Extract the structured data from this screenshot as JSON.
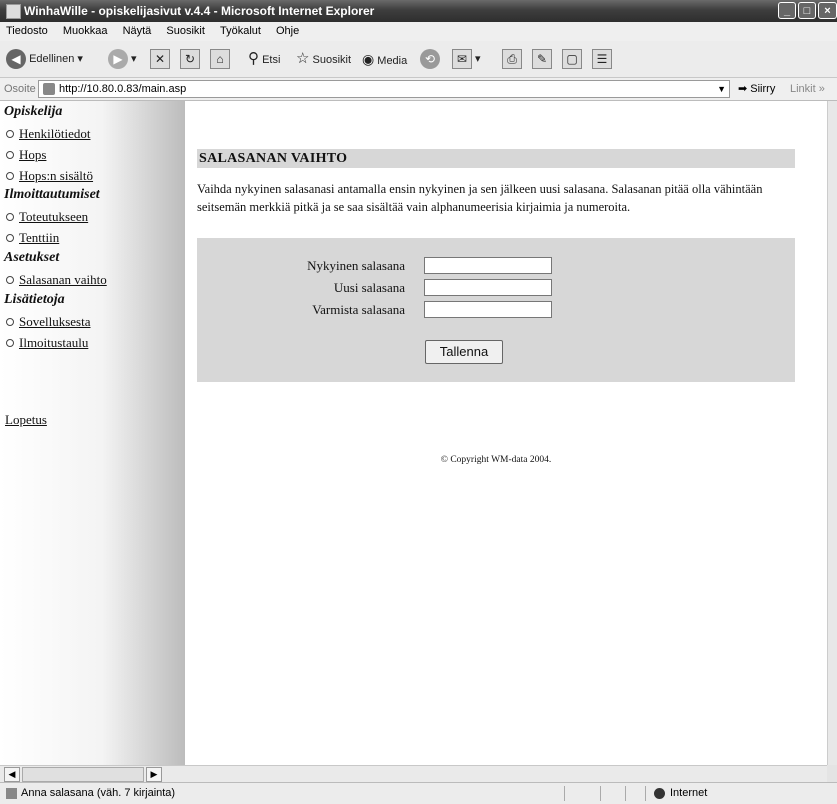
{
  "window": {
    "title": "WinhaWille - opiskelijasivut v.4.4 - Microsoft Internet Explorer",
    "controls": {
      "minimize": "_",
      "maximize": "□",
      "close": "×"
    }
  },
  "menu": [
    "Tiedosto",
    "Muokkaa",
    "Näytä",
    "Suosikit",
    "Työkalut",
    "Ohje"
  ],
  "toolbar": {
    "back_label": "Edellinen",
    "search_label": "Etsi",
    "favorites_label": "Suosikit",
    "media_label": "Media",
    "icons": [
      "back-icon",
      "forward-icon",
      "stop-icon",
      "refresh-icon",
      "home-icon",
      "search-icon",
      "favorites-icon",
      "media-icon",
      "history-icon",
      "mail-icon",
      "print-icon",
      "edit-icon",
      "discuss-icon",
      "research-icon"
    ]
  },
  "address": {
    "label": "Osoite",
    "url": "http://10.80.0.83/main.asp",
    "go_label": "Siirry",
    "links_label": "Linkit"
  },
  "sidebar": {
    "sections": [
      {
        "title": "Opiskelija",
        "items": [
          "Henkilötiedot",
          "Hops",
          "Hops:n sisältö"
        ]
      },
      {
        "title": "Ilmoittautumiset",
        "items": [
          "Toteutukseen",
          "Tenttiin"
        ]
      },
      {
        "title": "Asetukset",
        "items": [
          "Salasanan vaihto"
        ]
      },
      {
        "title": "Lisätietoja",
        "items": [
          "Sovelluksesta",
          "Ilmoitustaulu"
        ]
      }
    ],
    "logout": "Lopetus"
  },
  "main": {
    "heading": "SALASANAN VAIHTO",
    "description": "Vaihda nykyinen salasanasi antamalla ensin nykyinen ja sen jälkeen uusi salasana. Salasanan pitää olla vähintään seitsemän merkkiä pitkä ja se saa sisältää vain alphanumeerisia kirjaimia ja numeroita.",
    "fields": {
      "current_label": "Nykyinen salasana",
      "current_value": "",
      "new_label": "Uusi salasana",
      "new_value": "",
      "confirm_label": "Varmista salasana",
      "confirm_value": ""
    },
    "save_button": "Tallenna",
    "copyright": "© Copyright  WM-data 2004."
  },
  "statusbar": {
    "message": "Anna salasana (väh. 7 kirjainta)",
    "zone": "Internet"
  }
}
